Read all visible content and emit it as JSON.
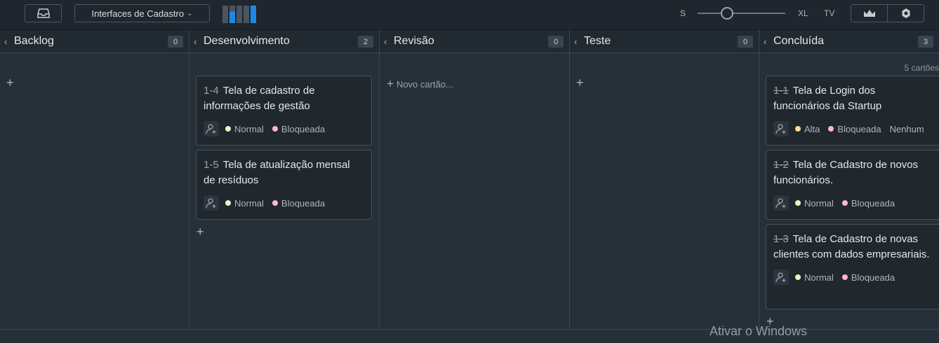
{
  "toolbar": {
    "board_name": "Interfaces de Cadastro",
    "size_small": "S",
    "size_large": "XL",
    "tv_label": "TV",
    "accent": "#1e88e5"
  },
  "columns": [
    {
      "title": "Backlog",
      "count": "0"
    },
    {
      "title": "Desenvolvimento",
      "count": "2"
    },
    {
      "title": "Revisão",
      "count": "0",
      "new_card": "Novo cartão..."
    },
    {
      "title": "Teste",
      "count": "0"
    },
    {
      "title": "Concluída",
      "count": "3",
      "cards_count": "5 cartões"
    }
  ],
  "dev_cards": [
    {
      "id": "1-4",
      "title": "Tela de cadastro de informações de gestão",
      "priority": "Normal",
      "status": "Bloqueada"
    },
    {
      "id": "1-5",
      "title": "Tela de atualização mensal de resíduos",
      "priority": "Normal",
      "status": "Bloqueada"
    }
  ],
  "done_cards": [
    {
      "id": "1-1",
      "title": "Tela de Login dos funcionários da Startup",
      "priority": "Alta",
      "status": "Bloqueada",
      "extra": "Nenhum"
    },
    {
      "id": "1-2",
      "title": "Tela de Cadastro de novos funcionários.",
      "priority": "Normal",
      "status": "Bloqueada"
    },
    {
      "id": "1-3",
      "title": "Tela de Cadastro de novas clientes com dados empresariais.",
      "priority": "Normal",
      "status": "Bloqueada"
    }
  ],
  "colors": {
    "normal": "#e6f7c4",
    "alta": "#ffe08a",
    "bloqueada": "#ffb3e0"
  },
  "watermark": "Ativar o Windows"
}
